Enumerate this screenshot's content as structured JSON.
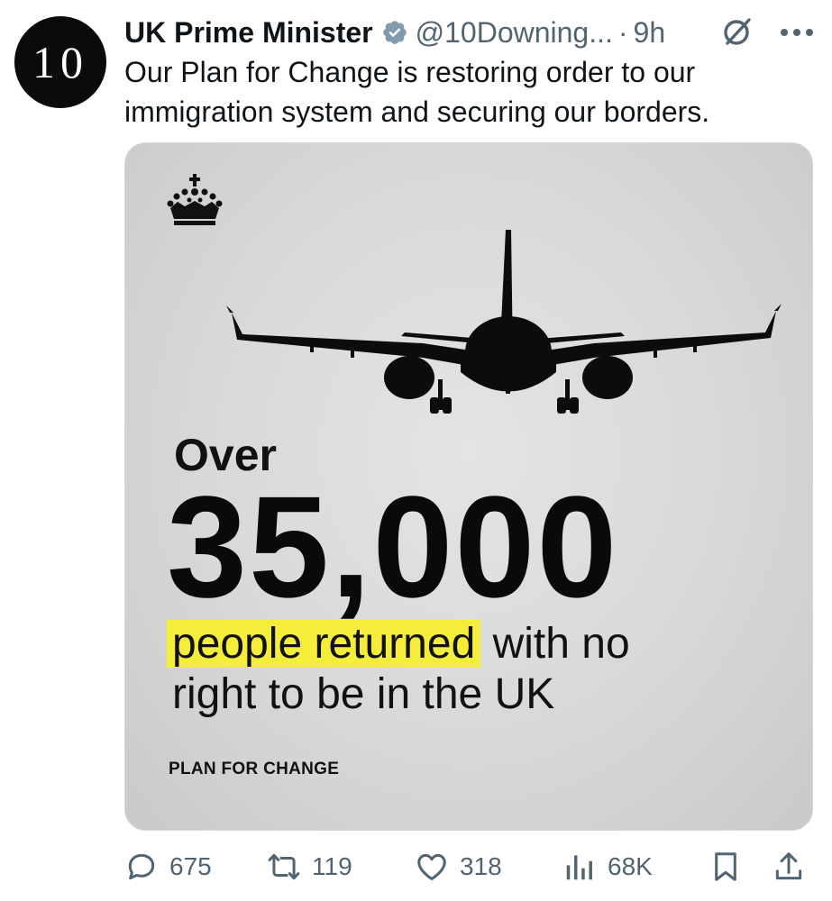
{
  "author": {
    "avatar_text": "10",
    "name": "UK Prime Minister",
    "handle": "@10Downing...",
    "separator": "·",
    "time": "9h",
    "verified_color": "#829aab"
  },
  "tweet": {
    "text_line1": "Our Plan for Change is restoring order to our",
    "text_line2": "immigration system and securing our borders."
  },
  "media": {
    "over": "Over",
    "number": "35,000",
    "highlight": "people returned",
    "rest_line1": " with no",
    "line2": "right to be in the UK",
    "footer": "PLAN FOR CHANGE",
    "highlight_color": "#f4ee3a"
  },
  "actions": {
    "replies": "675",
    "reposts": "119",
    "likes": "318",
    "views": "68K"
  },
  "icons": {
    "grok": "grok-icon",
    "more": "more-icon",
    "reply": "reply-icon",
    "repost": "repost-icon",
    "like": "heart-icon",
    "views": "views-icon",
    "bookmark": "bookmark-icon",
    "share": "share-icon"
  }
}
